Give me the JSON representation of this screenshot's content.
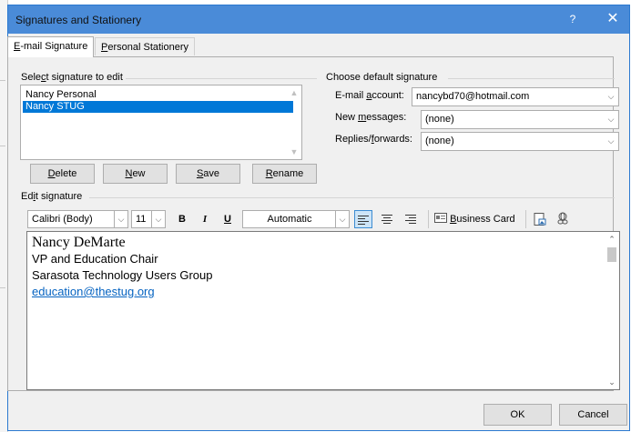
{
  "window": {
    "title": "Signatures and Stationery",
    "help_label": "?",
    "close_label": "✕"
  },
  "tabs": [
    {
      "label_ul": "E",
      "label_rest": "-mail Signature",
      "active": true
    },
    {
      "label_ul": "P",
      "label_rest": "ersonal Stationery",
      "active": false
    }
  ],
  "select_group": {
    "label_pre": "Sele",
    "label_ul": "c",
    "label_post": "t signature to edit",
    "items": [
      {
        "label": "Nancy Personal",
        "selected": false
      },
      {
        "label": "Nancy STUG",
        "selected": true
      }
    ]
  },
  "buttons": {
    "delete": {
      "ul": "D",
      "rest": "elete"
    },
    "new": {
      "ul": "N",
      "rest": "ew"
    },
    "save": {
      "ul": "S",
      "rest": "ave"
    },
    "rename": {
      "ul": "R",
      "rest": "ename"
    }
  },
  "default_group": {
    "label": "Choose default signature",
    "email_account_label_pre": "E-mail ",
    "email_account_label_ul": "a",
    "email_account_label_post": "ccount:",
    "email_account_value": "nancybd70@hotmail.com",
    "new_messages_label_pre": "New ",
    "new_messages_label_ul": "m",
    "new_messages_label_post": "essages:",
    "new_messages_value": "(none)",
    "replies_label_pre": "Replies/",
    "replies_label_ul": "f",
    "replies_label_post": "orwards:",
    "replies_value": "(none)"
  },
  "edit_group": {
    "label_pre": "Ed",
    "label_ul": "i",
    "label_post": "t signature"
  },
  "toolbar": {
    "font_name": "Calibri (Body)",
    "font_size": "11",
    "bold": "B",
    "italic": "I",
    "underline": "U",
    "color": "Automatic",
    "business_card_ul": "B",
    "business_card_rest": "usiness Card"
  },
  "signature": {
    "line1": "Nancy DeMarte",
    "line2": "VP and Education Chair",
    "line3": "Sarasota Technology Users Group",
    "line4": "education@thestug.org"
  },
  "footer": {
    "ok": "OK",
    "cancel": "Cancel"
  },
  "colors": {
    "titlebar": "#4a8bd8",
    "selection": "#0078d7",
    "link": "#0563c1"
  }
}
